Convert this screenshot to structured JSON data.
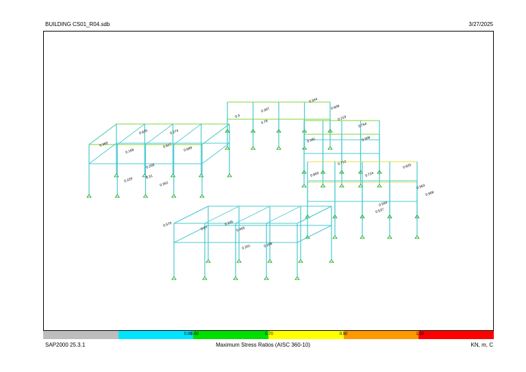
{
  "header": {
    "file_title": "BUILDING CS01_R04.sdb",
    "date": "3/27/2025"
  },
  "footer": {
    "program": "SAP2000 25.3.1",
    "plot_title": "Maximum Stress Ratios  (AISC 360-10)",
    "units": "KN, m, C"
  },
  "legend": {
    "segments": [
      {
        "color": "#bdbdbd",
        "label": ""
      },
      {
        "color": "#00e4ff",
        "label": "0.00"
      },
      {
        "color": "#00e000",
        "label": "0.50"
      },
      {
        "color": "#ffff00",
        "label": "0.70"
      },
      {
        "color": "#ff9900",
        "label": "0.90"
      },
      {
        "color": "#ff0000",
        "label": "1.00"
      }
    ]
  },
  "colors": {
    "column": "#47c8d0",
    "beam_low": "#47c8d0",
    "beam_mid": "#7bd637",
    "beam_high": "#e0e04a",
    "support": "#00a000"
  },
  "stress_labels": [
    "0.369",
    "0.625",
    "0.274",
    "0.168",
    "0.617",
    "0.689",
    "0.258",
    "0.229",
    "0.31",
    "0.352",
    "0.3",
    "0.307",
    "0.344",
    "0.608",
    "0.78",
    "0.219",
    "0.764",
    "0.308",
    "0.181",
    "0.803",
    "0.712",
    "0.724",
    "0.825",
    "0.363",
    "0.908",
    "0.594",
    "0.537",
    "0.579",
    "0.07",
    "0.335",
    "0.455",
    "0.201",
    "0.208"
  ]
}
